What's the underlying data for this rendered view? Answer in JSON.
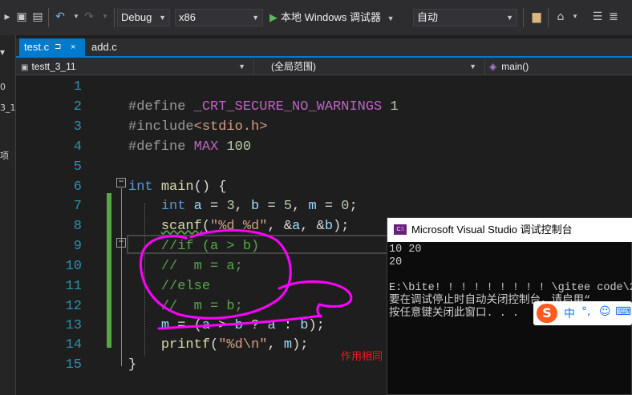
{
  "toolbar": {
    "config": "Debug",
    "platform": "x86",
    "run_label": "本地 Windows 调试器",
    "mode": "自动"
  },
  "left_strip": [
    "0",
    "3_1",
    "项"
  ],
  "tabs": [
    {
      "label": "test.c",
      "pin": "⊐",
      "close": "×"
    },
    {
      "label": "add.c"
    }
  ],
  "navbar": {
    "project": "testt_3_11",
    "scope": "(全局范围)",
    "member": "main()"
  },
  "editor": {
    "lines": [
      {
        "n": "1"
      },
      {
        "n": "2"
      },
      {
        "n": "3"
      },
      {
        "n": "4"
      },
      {
        "n": "5"
      },
      {
        "n": "6"
      },
      {
        "n": "7"
      },
      {
        "n": "8"
      },
      {
        "n": "9"
      },
      {
        "n": "10"
      },
      {
        "n": "11"
      },
      {
        "n": "12"
      },
      {
        "n": "13"
      },
      {
        "n": "14"
      },
      {
        "n": "15"
      }
    ],
    "fold_minus": "−"
  },
  "console": {
    "title": "Microsoft Visual Studio 调试控制台",
    "icon": "C:\\",
    "lines": [
      "10 20",
      "20",
      "",
      "E:\\bite! ! ! ! ! ! ! ! ! \\gitee code\\2",
      "要在调试停止时自动关闭控制台，请启用“",
      "按任意键关闭此窗口. . ."
    ]
  },
  "ime": {
    "logo": "S",
    "items": [
      "中",
      "°,",
      "☺",
      "⌨"
    ]
  },
  "annotation": "作用相同",
  "colors": {
    "accent": "#007acc",
    "annotation": "#e8201e",
    "circle": "#ff00ff"
  }
}
